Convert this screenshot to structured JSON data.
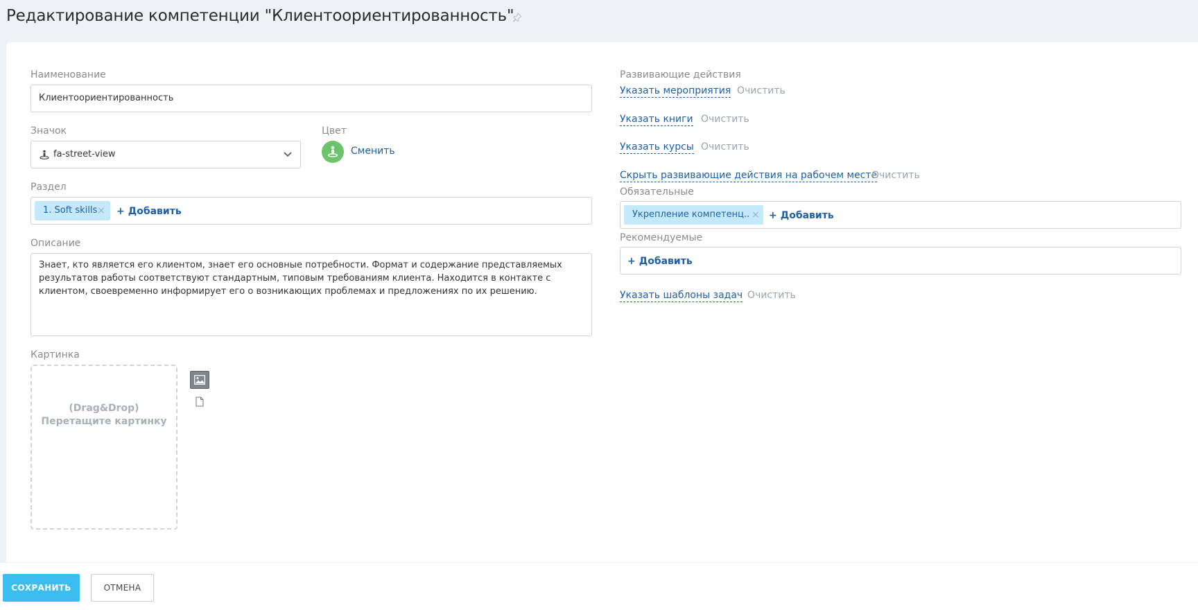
{
  "page": {
    "title": "Редактирование компетенции \"Клиентоориентированность\""
  },
  "form": {
    "name_label": "Наименование",
    "name_value": "Клиентоориентированность",
    "icon_label": "Значок",
    "icon_value": "fa-street-view",
    "color_label": "Цвет",
    "color_value": "#6cc36c",
    "color_change": "Сменить",
    "section_label": "Раздел",
    "section_tags": [
      "1. Soft skills"
    ],
    "section_add": "Добавить",
    "description_label": "Описание",
    "description_value": "Знает, кто является его клиентом, знает его основные потребности. Формат и содержание представляемых результатов работы соответствуют стандартным, типовым требованиям клиента. Находится в контакте с клиентом, своевременно информирует его о возникающих проблемах и предложениях по их решению.",
    "picture_label": "Картинка",
    "dropzone_line1": "(Drag&Drop)",
    "dropzone_line2": "Перетащите картинку"
  },
  "dev": {
    "label": "Развивающие действия",
    "events_link": "Указать мероприятия",
    "books_link": "Указать книги",
    "courses_link": "Указать курсы",
    "hide_link": "Скрыть развивающие действия на рабочем месте",
    "clear": "Очистить",
    "required_label": "Обязательные",
    "required_tags": [
      "Укрепление компетенц..."
    ],
    "required_add": "Добавить",
    "recommended_label": "Рекомендуемые",
    "recommended_add": "Добавить",
    "templates_link": "Указать шаблоны задач"
  },
  "footer": {
    "save": "СОХРАНИТЬ",
    "cancel": "ОТМЕНА"
  }
}
